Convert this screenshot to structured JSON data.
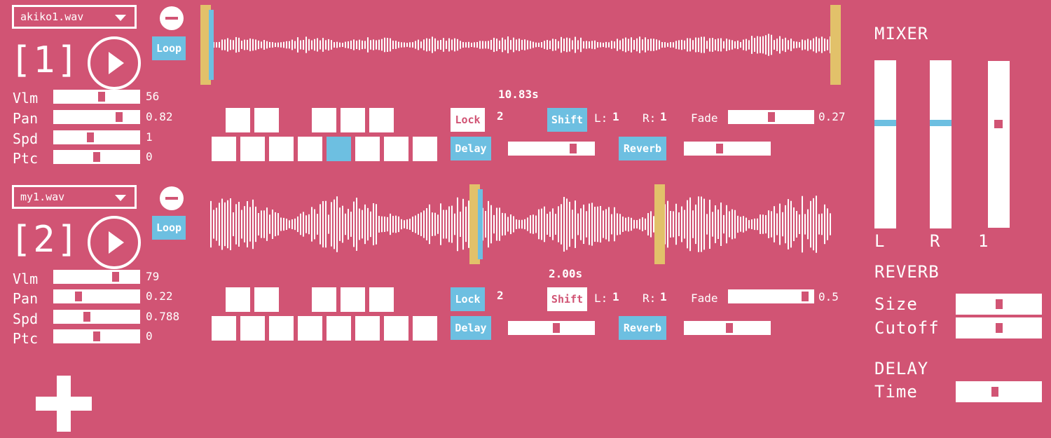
{
  "colors": {
    "background": "#d15474",
    "accent_blue": "#6dbfe1",
    "marker_gold": "#e2c16a",
    "white": "#ffffff"
  },
  "tracks": [
    {
      "file": "akiko1.wav",
      "number": "[1]",
      "loop_label": "Loop",
      "loop_active": true,
      "params": [
        {
          "label": "Vlm",
          "value": "56",
          "level": 0.56
        },
        {
          "label": "Pan",
          "value": "0.82",
          "level": 0.78
        },
        {
          "label": "Spd",
          "value": "1",
          "level": 0.42
        },
        {
          "label": "Ptc",
          "value": "0",
          "level": 0.5
        }
      ],
      "duration": "10.83s",
      "pads_top_active": [
        false,
        false,
        false,
        false,
        false
      ],
      "pads_bottom_active": [
        false,
        false,
        false,
        false,
        true,
        false,
        false,
        false
      ],
      "lock_label": "Lock",
      "lock_active": false,
      "lock_value": "2",
      "shift_label": "Shift",
      "shift_active": true,
      "l_label": "L:",
      "l_value": "1",
      "r_label": "R:",
      "r_value": "1",
      "fade_label": "Fade",
      "fade_value": "0.27",
      "fade_level": 0.5,
      "delay_label": "Delay",
      "delay_level": 0.77,
      "reverb_label": "Reverb",
      "reverb_level": 0.4,
      "start_marker": 0.0,
      "end_marker": 1.0
    },
    {
      "file": "my1.wav",
      "number": "[2]",
      "loop_label": "Loop",
      "loop_active": true,
      "params": [
        {
          "label": "Vlm",
          "value": "79",
          "level": 0.74
        },
        {
          "label": "Pan",
          "value": "0.22",
          "level": 0.27
        },
        {
          "label": "Spd",
          "value": "0.788",
          "level": 0.38
        },
        {
          "label": "Ptc",
          "value": "0",
          "level": 0.5
        }
      ],
      "duration": "2.00s",
      "pads_top_active": [
        false,
        false,
        false,
        false,
        false
      ],
      "pads_bottom_active": [
        false,
        false,
        false,
        false,
        false,
        false,
        false,
        false
      ],
      "lock_label": "Lock",
      "lock_active": true,
      "lock_value": "2",
      "shift_label": "Shift",
      "shift_active": false,
      "l_label": "L:",
      "l_value": "1",
      "r_label": "R:",
      "r_value": "1",
      "fade_label": "Fade",
      "fade_value": "0.5",
      "fade_level": 0.93,
      "delay_label": "Delay",
      "delay_level": 0.56,
      "reverb_label": "Reverb",
      "reverb_level": 0.53,
      "start_marker": 0.42,
      "end_marker": 0.72
    }
  ],
  "mixer": {
    "title": "MIXER",
    "channels": [
      {
        "label": "L",
        "level": 0.63
      },
      {
        "label": "R",
        "level": 0.63
      },
      {
        "label": "1",
        "level": 0.63
      }
    ]
  },
  "reverb": {
    "title": "REVERB",
    "size_label": "Size",
    "size_level": 0.5,
    "cutoff_label": "Cutoff",
    "cutoff_level": 0.5
  },
  "delay": {
    "title": "DELAY",
    "time_label": "Time",
    "time_level": 0.45
  },
  "add_track_icon": "plus-icon"
}
